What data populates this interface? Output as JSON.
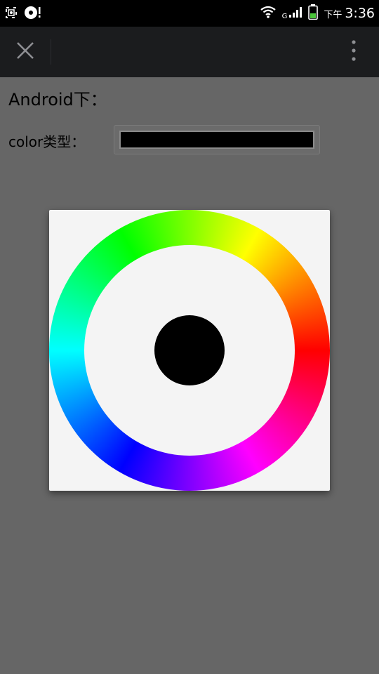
{
  "status_bar": {
    "network_type": "G",
    "am_pm": "下午",
    "time": "3:36",
    "icons": [
      "screenshot-icon",
      "sync-icon",
      "wifi-icon",
      "signal-icon",
      "battery-icon"
    ]
  },
  "toolbar": {
    "close_icon": "close-icon",
    "menu_icon": "overflow-menu-icon"
  },
  "main": {
    "heading": "Android下：",
    "color_label": "color类型：",
    "color_value": "#000000"
  },
  "picker": {
    "center_color": "#000000",
    "ring_colors": [
      "#ff0000",
      "#ff00ff",
      "#0000ff",
      "#00ffff",
      "#00ff00",
      "#ffff00"
    ]
  },
  "colors": {
    "background": "#666666",
    "toolbar": "#1b1c1e",
    "status_bar": "#000000",
    "dialog": "#f4f4f4"
  }
}
